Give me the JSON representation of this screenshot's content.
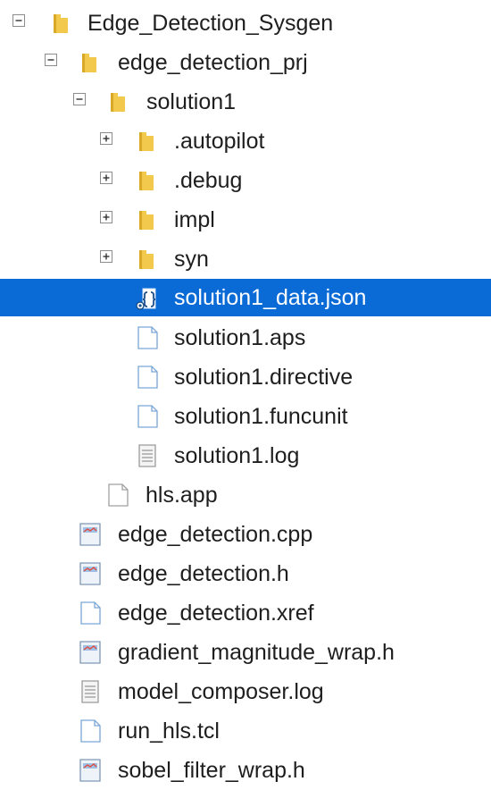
{
  "tree": {
    "root_label": "Edge_Detection_Sysgen",
    "project_label": "edge_detection_prj",
    "solution_label": "solution1",
    "folders": [
      ".autopilot",
      ".debug",
      "impl",
      "syn"
    ],
    "solution_files": [
      "solution1_data.json",
      "solution1.aps",
      "solution1.directive",
      "solution1.funcunit",
      "solution1.log"
    ],
    "project_file": "hls.app",
    "root_files": [
      "edge_detection.cpp",
      "edge_detection.h",
      "edge_detection.xref",
      "gradient_magnitude_wrap.h",
      "model_composer.log",
      "run_hls.tcl",
      "sobel_filter_wrap.h"
    ],
    "selected_item": "solution1_data.json"
  },
  "colors": {
    "selection": "#0a6ad6",
    "folder": "#f2c94c",
    "toggle_border": "#8c8c8c",
    "text": "#1e1e1e"
  }
}
